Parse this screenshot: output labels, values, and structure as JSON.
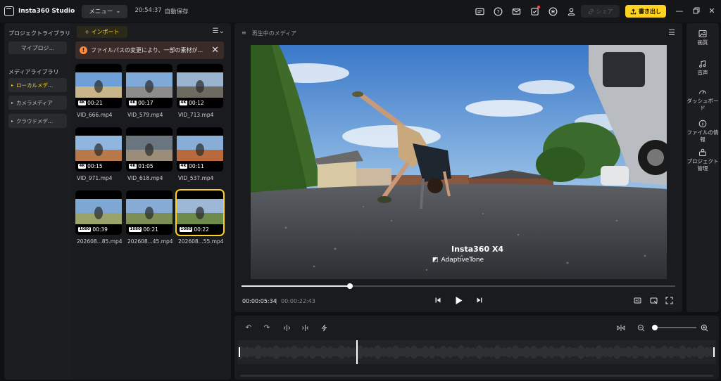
{
  "titlebar": {
    "app_name": "Insta360 Studio",
    "menu_label": "メニュー",
    "autosave_time": "20:54:37",
    "autosave_label": "自動保存",
    "icons": [
      "subtitle-icon",
      "help-icon",
      "mail-icon",
      "task-icon",
      "creator-icon",
      "user-icon"
    ],
    "share_label": "シェア",
    "export_label": "書き出し"
  },
  "library": {
    "project_library_label": "プロジェクトライブラリ",
    "my_projects_label": "マイプロジ...",
    "media_library_label": "メディアライブラリ",
    "items": [
      {
        "label": "ローカルメデ...",
        "active": true
      },
      {
        "label": "カメラメディア",
        "active": false
      },
      {
        "label": "クラウドメデ...",
        "active": false
      }
    ]
  },
  "media": {
    "import_label": "+ インポート",
    "warning_text": "ファイルパスの変更により、一部の素材が...",
    "thumbnails": [
      {
        "name": "VID_666.mp4",
        "badge": "4K",
        "duration": "00:21",
        "selected": false
      },
      {
        "name": "VID_579.mp4",
        "badge": "4K",
        "duration": "00:17",
        "selected": false
      },
      {
        "name": "VID_713.mp4",
        "badge": "4K",
        "duration": "00:12",
        "selected": false
      },
      {
        "name": "VID_971.mp4",
        "badge": "4K",
        "duration": "00:15",
        "selected": false
      },
      {
        "name": "VID_618.mp4",
        "badge": "4K",
        "duration": "01:05",
        "selected": false
      },
      {
        "name": "VID_537.mp4",
        "badge": "4K",
        "duration": "00:11",
        "selected": false
      },
      {
        "name": "202608...85.mp4",
        "badge": "1080",
        "duration": "00:39",
        "selected": false
      },
      {
        "name": "202608...45.mp4",
        "badge": "1080",
        "duration": "00:21",
        "selected": false
      },
      {
        "name": "202608...55.mp4",
        "badge": "1080",
        "duration": "00:22",
        "selected": true
      }
    ]
  },
  "preview": {
    "title": "再生中のメディア",
    "watermark_brand": "Insta360 X4",
    "watermark_sub": "AdaptiveTone",
    "current_time": "00:00:05:34",
    "separator": "|",
    "total_time": "00:00:22:43",
    "progress": 0.25
  },
  "tools": [
    {
      "label": "画質",
      "icon": "image-icon"
    },
    {
      "label": "音声",
      "icon": "audio-icon"
    },
    {
      "label": "ダッシュボード",
      "icon": "gauge-icon"
    },
    {
      "label": "ファイルの情報",
      "icon": "info-icon"
    },
    {
      "label": "プロジェクト管理",
      "icon": "project-icon"
    }
  ],
  "timeline": {
    "zoom_level": 0.05,
    "playhead_fraction": 0.25
  },
  "colors": {
    "accent": "#ffd21f",
    "warning": "#ff8a3d",
    "background": "#0f1012",
    "panel": "#1a1b1e"
  }
}
